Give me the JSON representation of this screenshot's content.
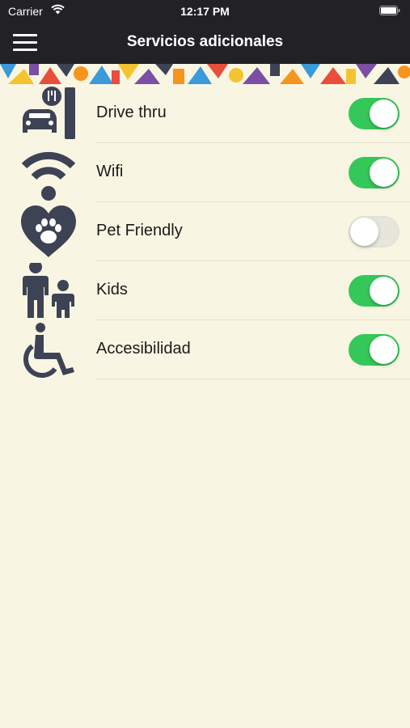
{
  "status_bar": {
    "carrier": "Carrier",
    "time": "12:17 PM"
  },
  "nav": {
    "title": "Servicios adicionales"
  },
  "colors": {
    "bar": "#222226",
    "background": "#f8f6e3",
    "toggle_on": "#34c759",
    "toggle_off": "#e6e6dc",
    "icon": "#3d4254"
  },
  "services": [
    {
      "label": "Drive thru",
      "icon": "drive-thru-icon",
      "enabled": true
    },
    {
      "label": "Wifi",
      "icon": "wifi-icon",
      "enabled": true
    },
    {
      "label": "Pet Friendly",
      "icon": "pet-friendly-icon",
      "enabled": false
    },
    {
      "label": "Kids",
      "icon": "kids-icon",
      "enabled": true
    },
    {
      "label": "Accesibilidad",
      "icon": "wheelchair-icon",
      "enabled": true
    }
  ]
}
